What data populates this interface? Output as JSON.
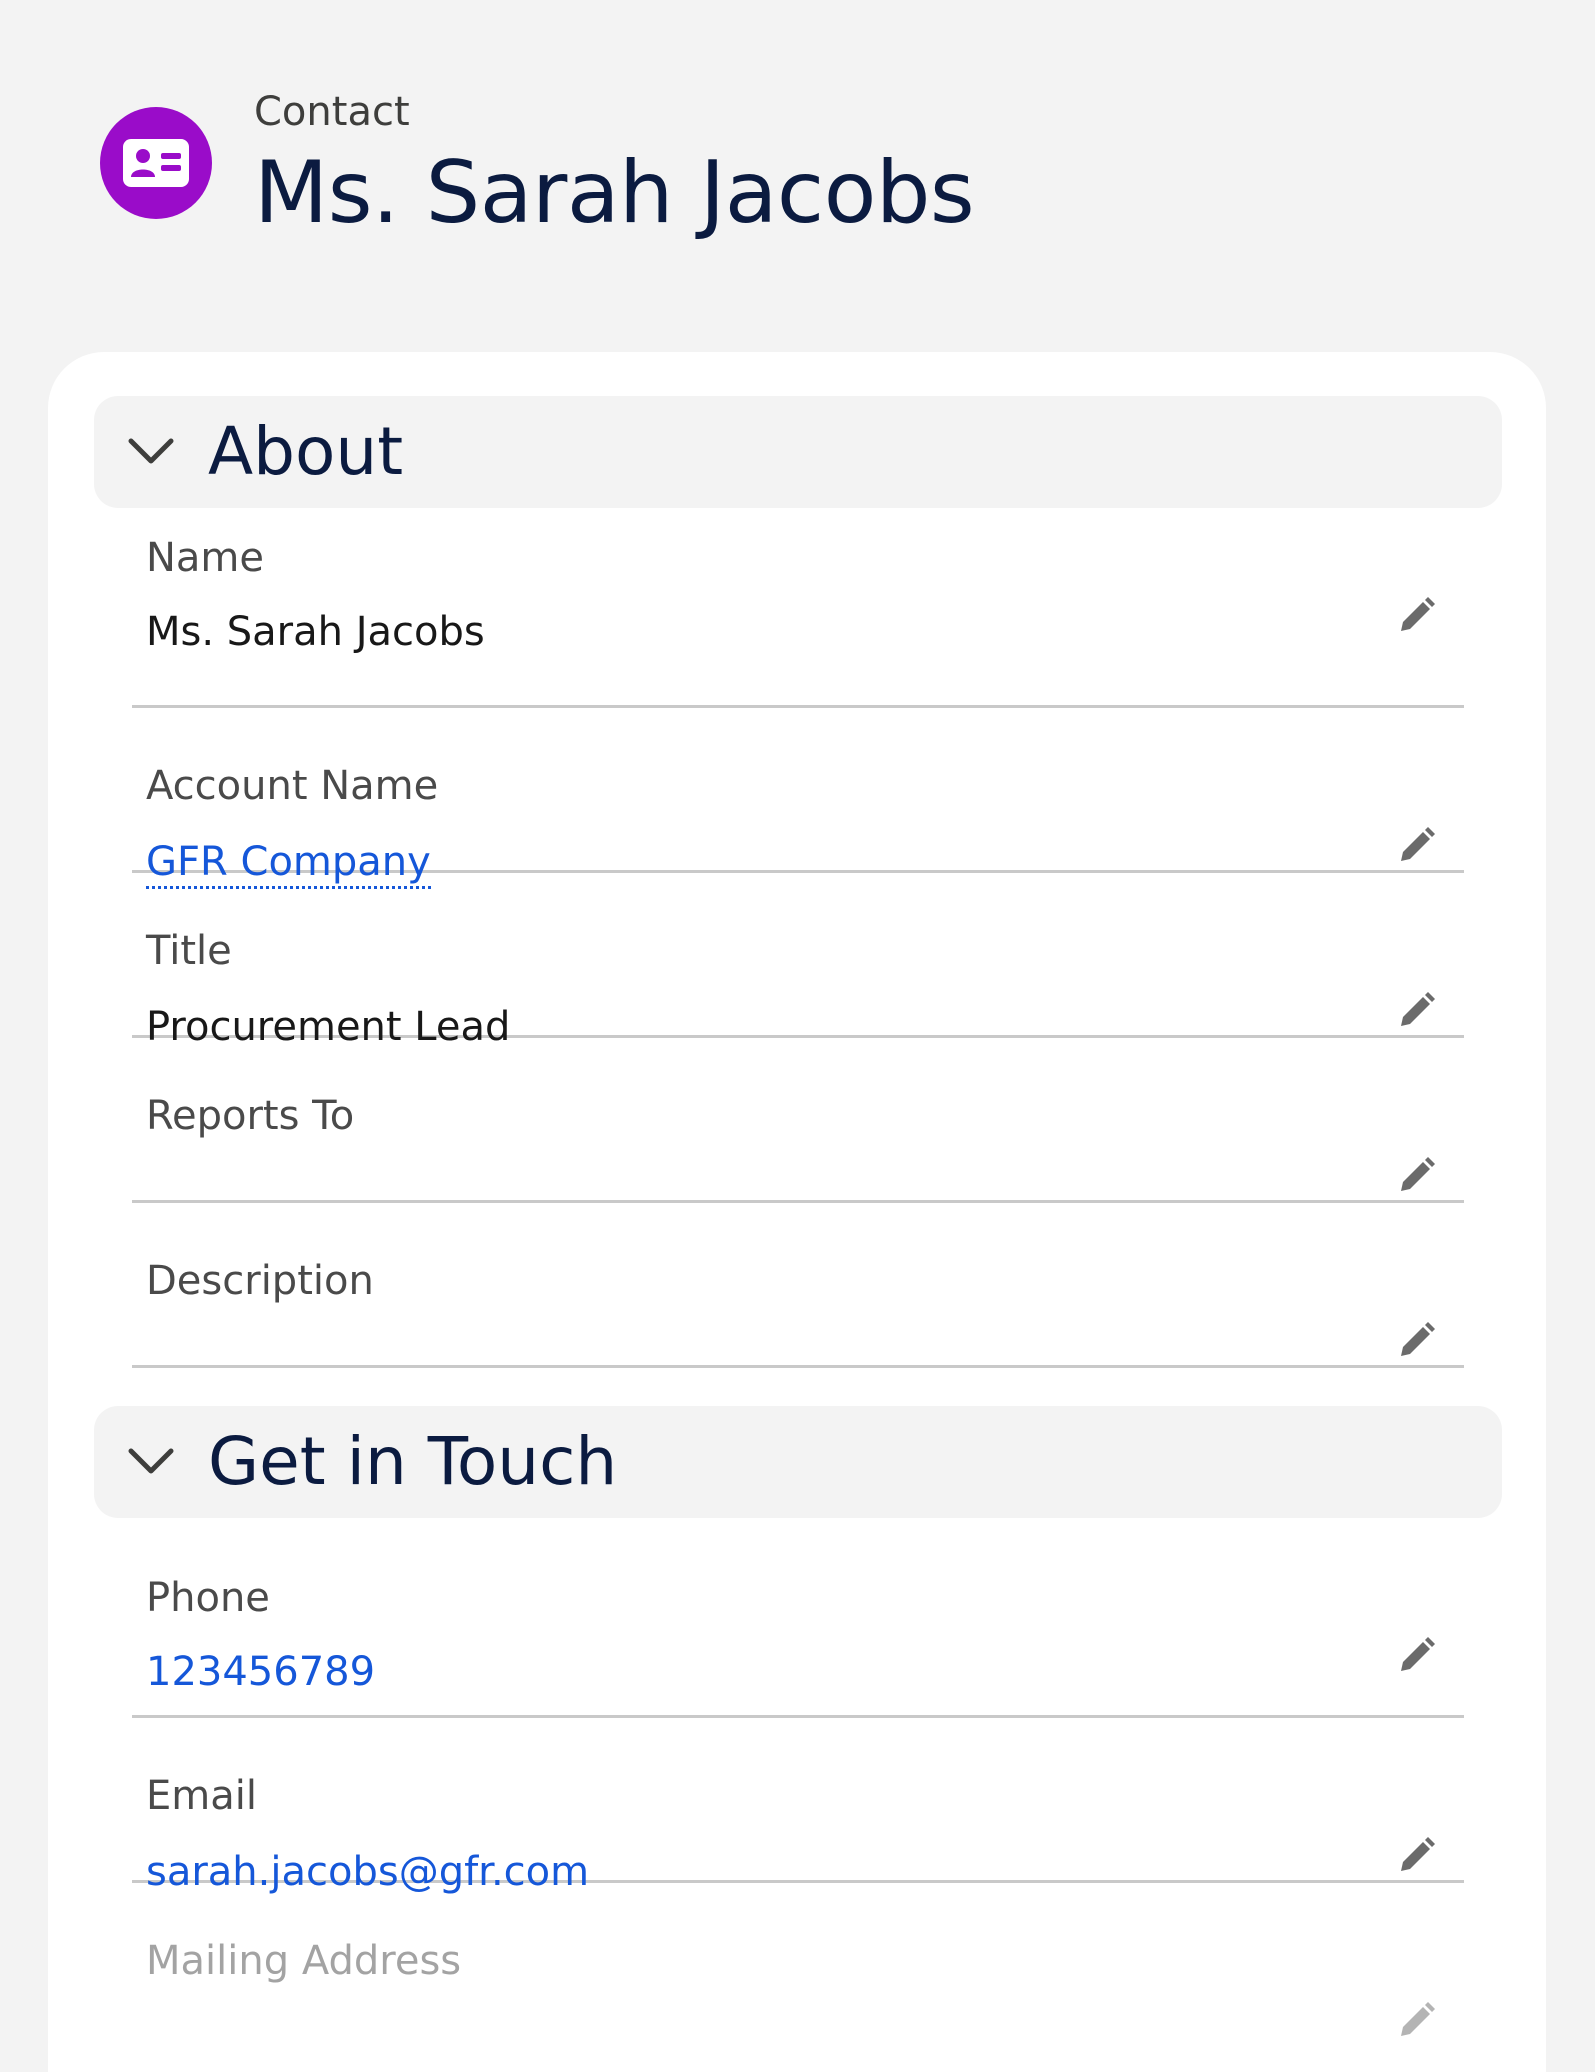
{
  "header": {
    "object_label": "Contact",
    "record_name": "Ms. Sarah Jacobs",
    "icon": "contact-card-icon",
    "icon_color": "#9a0cc9"
  },
  "sections": [
    {
      "title": "About",
      "icon": "chevron-down-icon",
      "fields": [
        {
          "label": "Name",
          "value": "Ms. Sarah Jacobs"
        },
        {
          "label": "Account Name",
          "value": "GFR Company"
        },
        {
          "label": "Title",
          "value": "Procurement Lead"
        },
        {
          "label": "Reports To",
          "value": ""
        },
        {
          "label": "Description",
          "value": ""
        }
      ]
    },
    {
      "title": "Get in Touch",
      "icon": "chevron-down-icon",
      "fields": [
        {
          "label": "Phone",
          "value": "123456789"
        },
        {
          "label": "Email",
          "value": "sarah.jacobs@gfr.com"
        },
        {
          "label": "Mailing Address",
          "value": ""
        }
      ]
    }
  ],
  "colors": {
    "link": "#1557d9",
    "title_text": "#0b1b40",
    "page_bg": "#f3f3f3"
  }
}
